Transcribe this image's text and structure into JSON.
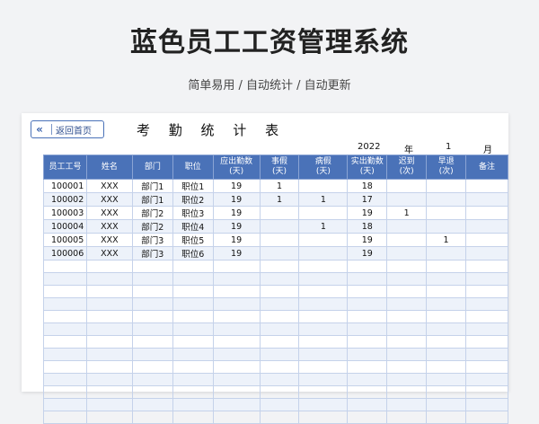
{
  "page": {
    "title": "蓝色员工工资管理系统",
    "subtitle": "简单易用 / 自动统计 / 自动更新"
  },
  "sheet": {
    "back_label": "返回首页",
    "back_icon": "double-chevron-left-icon",
    "title": "考 勤 统 计 表",
    "year": "2022",
    "year_unit": "年",
    "month": "1",
    "month_unit": "月",
    "headers": [
      "员工工号",
      "姓名",
      "部门",
      "职位",
      "应出勤数\n(天)",
      "事假\n(天)",
      "病假\n(天)",
      "实出勤数\n(天)",
      "迟到\n(次)",
      "早退\n(次)",
      "备注"
    ],
    "rows": [
      [
        "100001",
        "XXX",
        "部门1",
        "职位1",
        "19",
        "1",
        "",
        "18",
        "",
        "",
        ""
      ],
      [
        "100002",
        "XXX",
        "部门1",
        "职位2",
        "19",
        "1",
        "1",
        "17",
        "",
        "",
        ""
      ],
      [
        "100003",
        "XXX",
        "部门2",
        "职位3",
        "19",
        "",
        "",
        "19",
        "1",
        "",
        ""
      ],
      [
        "100004",
        "XXX",
        "部门2",
        "职位4",
        "19",
        "",
        "1",
        "18",
        "",
        "",
        ""
      ],
      [
        "100005",
        "XXX",
        "部门3",
        "职位5",
        "19",
        "",
        "",
        "19",
        "",
        "1",
        ""
      ],
      [
        "100006",
        "XXX",
        "部门3",
        "职位6",
        "19",
        "",
        "",
        "19",
        "",
        "",
        ""
      ]
    ],
    "empty_rows": 13,
    "colors": {
      "header": "#4a72b8",
      "alt_row": "#edf2fa",
      "border": "#c5d2ea"
    }
  }
}
